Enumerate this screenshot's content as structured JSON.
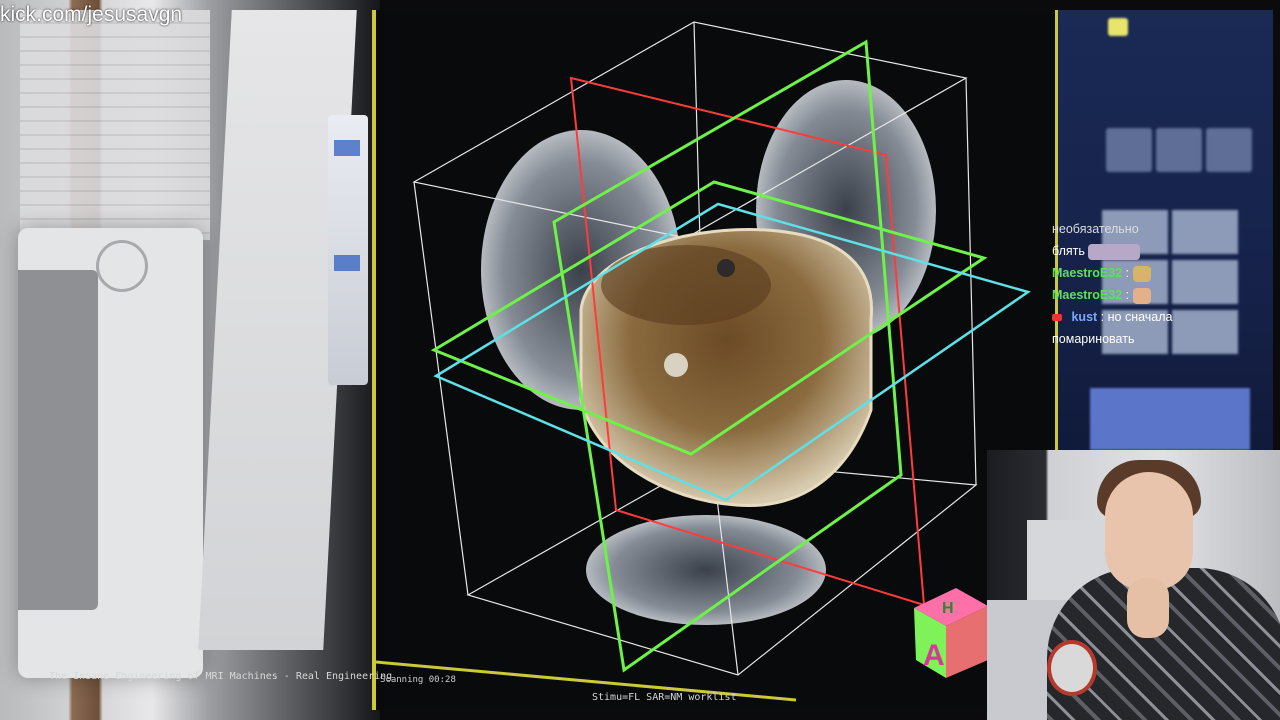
{
  "watermark": "kick.com/jesusavgn",
  "video_title": "The Insane Engineering of MRI Machines - Real Engineering",
  "scan_label": "Scanning 00:28",
  "status_line": "Stimu=FL SAR=NM worklist",
  "orientation_cube": {
    "face_top": "H",
    "face_front": "A"
  },
  "chat": {
    "messages": [
      {
        "user": "",
        "text": "необязательно",
        "color": "#5ee05e"
      },
      {
        "user": "",
        "text": "блять",
        "color": "#5ee05e"
      },
      {
        "user": "MaestroE32",
        "text": ":",
        "color": "#5ee05e"
      },
      {
        "user": "MaestroE32",
        "text": ":",
        "color": "#5ee05e"
      },
      {
        "user": "kust",
        "text": ": но сначала",
        "color": "#7aa8ff"
      },
      {
        "user": "",
        "text": "помариновать",
        "color": "#ffffff"
      }
    ]
  },
  "colors": {
    "frame_green": "#6ef24a",
    "frame_red": "#ff3b3b",
    "frame_cyan": "#5de0e6",
    "monitor_border": "#cbc93a"
  }
}
